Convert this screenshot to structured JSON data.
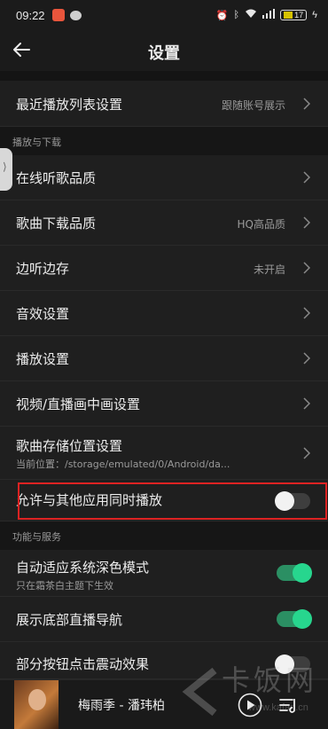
{
  "status_bar": {
    "time": "09:22",
    "battery": "17"
  },
  "header": {
    "title": "设置"
  },
  "rows": {
    "recent_playlist": {
      "label": "最近播放列表设置",
      "value": "跟随账号展示"
    },
    "online_quality": {
      "label": "在线听歌品质"
    },
    "download_quality": {
      "label": "歌曲下载品质",
      "value": "HQ高品质"
    },
    "listen_save": {
      "label": "边听边存",
      "value": "未开启"
    },
    "sound_effect": {
      "label": "音效设置"
    },
    "playback": {
      "label": "播放设置"
    },
    "pip": {
      "label": "视频/直播画中画设置"
    },
    "storage": {
      "label": "歌曲存储位置设置",
      "sub": "当前位置：/storage/emulated/0/Android/da..."
    },
    "allow_other": {
      "label": "允许与其他应用同时播放",
      "toggle": false
    },
    "dark_mode": {
      "label": "自动适应系统深色模式",
      "sub": "只在霜茶白主题下生效",
      "toggle": true
    },
    "live_nav": {
      "label": "展示底部直播导航",
      "toggle": true
    },
    "vibration": {
      "label": "部分按钮点击震动效果",
      "toggle": false
    }
  },
  "sections": {
    "play_download": "播放与下载",
    "features": "功能与服务"
  },
  "player": {
    "song": "梅雨季 - 潘玮柏"
  },
  "watermark": {
    "text": "卡饭网",
    "url": "www.kafan.cn"
  },
  "colors": {
    "toggle_on": "#27d68e",
    "highlight_box": "#dd2222"
  }
}
